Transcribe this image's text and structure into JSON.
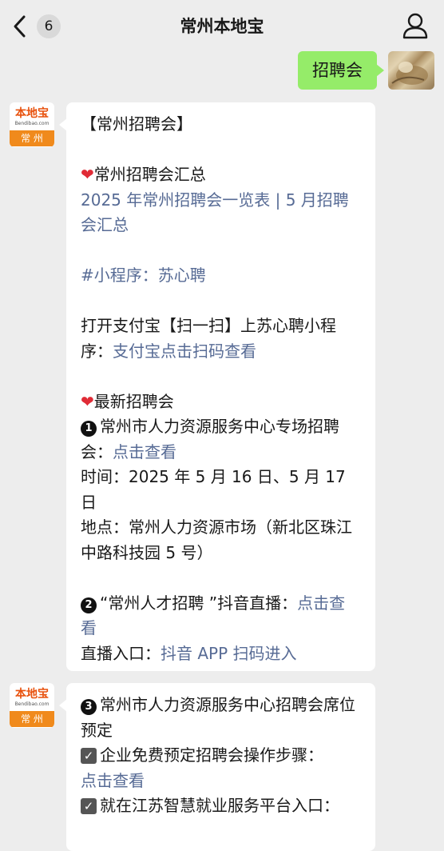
{
  "header": {
    "title": "常州本地宝",
    "unread_count": "6"
  },
  "sent": {
    "text": "招聘会"
  },
  "avatar": {
    "brand": "本地宝",
    "brand_en": "Bendibao.com",
    "city": "常 州"
  },
  "message1": {
    "heading": "【常州招聘会】",
    "summary_title": "常州招聘会汇总",
    "summary_link": "2025 年常州招聘会一览表 | 5 月招聘会汇总",
    "mini_program": "#小程序：苏心聘",
    "alipay_text": "打开支付宝【扫一扫】上苏心聘小程序：",
    "alipay_link": "支付宝点击扫码查看",
    "latest_title": "最新招聘会",
    "item1_num": "1",
    "item1_text": "常州市人力资源服务中心专场招聘会：",
    "item1_link": "点击查看",
    "item1_time": "时间：2025 年 5 月 16 日、5 月 17 日",
    "item1_place": "地点：常州人力资源市场（新北区珠江中路科技园 5 号）",
    "item2_num": "2",
    "item2_text": "“常州人才招聘 ”抖音直播：",
    "item2_link": "点击查看",
    "item2_entry_label": "直播入口：",
    "item2_entry_link": "抖音 APP 扫码进入"
  },
  "message2": {
    "item3_num": "3",
    "item3_text": "常州市人力资源服务中心招聘会席位预定",
    "check1_text": "企业免费预定招聘会操作步骤：",
    "check1_link": "点击查看",
    "check2_text": "就在江苏智慧就业服务平台入口："
  },
  "colors": {
    "link": "#576b95",
    "sent_bubble": "#95ec69",
    "background": "#ededed"
  }
}
